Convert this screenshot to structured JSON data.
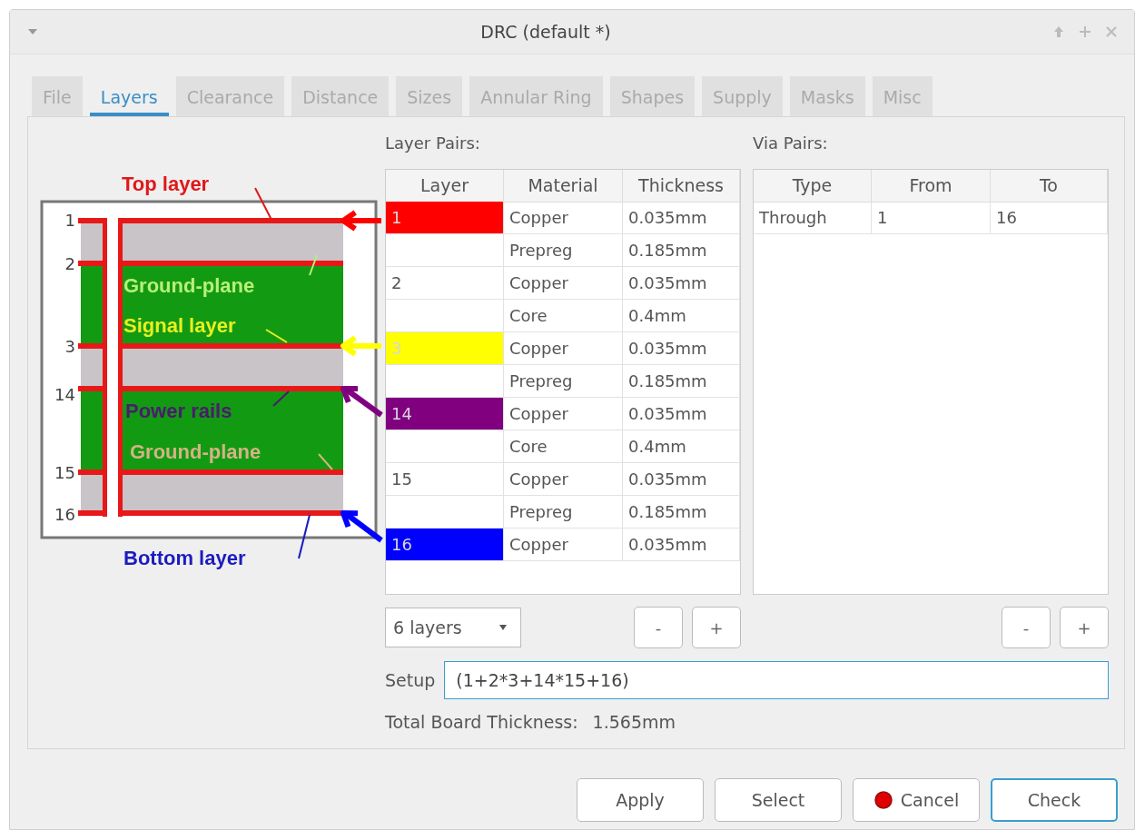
{
  "window": {
    "title": "DRC (default *)"
  },
  "tabs": [
    {
      "label": "File",
      "selected": false
    },
    {
      "label": "Layers",
      "selected": true
    },
    {
      "label": "Clearance",
      "selected": false
    },
    {
      "label": "Distance",
      "selected": false
    },
    {
      "label": "Sizes",
      "selected": false
    },
    {
      "label": "Annular Ring",
      "selected": false
    },
    {
      "label": "Shapes",
      "selected": false
    },
    {
      "label": "Supply",
      "selected": false
    },
    {
      "label": "Masks",
      "selected": false
    },
    {
      "label": "Misc",
      "selected": false
    }
  ],
  "diagram": {
    "layer_numbers": [
      "1",
      "2",
      "3",
      "14",
      "15",
      "16"
    ],
    "labels": [
      {
        "text": "Top layer",
        "color": "#e01818"
      },
      {
        "text": "Ground-plane",
        "color": "#b8f078"
      },
      {
        "text": "Signal layer",
        "color": "#e8f020"
      },
      {
        "text": "Power rails",
        "color": "#4a1c6c"
      },
      {
        "text": "Ground-plane",
        "color": "#d4b484"
      },
      {
        "text": "Bottom layer",
        "color": "#1c1cc0"
      }
    ]
  },
  "layer_pairs": {
    "title": "Layer Pairs:",
    "columns": [
      "Layer",
      "Material",
      "Thickness"
    ],
    "rows": [
      {
        "layer": "1",
        "color": "#ff0000",
        "material": "Copper",
        "thickness": "0.035mm"
      },
      {
        "layer": "",
        "material": "Prepreg",
        "thickness": "0.185mm"
      },
      {
        "layer": "2",
        "material": "Copper",
        "thickness": "0.035mm"
      },
      {
        "layer": "",
        "material": "Core",
        "thickness": "0.4mm"
      },
      {
        "layer": "3",
        "color": "#ffff00",
        "material": "Copper",
        "thickness": "0.035mm"
      },
      {
        "layer": "",
        "material": "Prepreg",
        "thickness": "0.185mm"
      },
      {
        "layer": "14",
        "color": "#800080",
        "material": "Copper",
        "thickness": "0.035mm"
      },
      {
        "layer": "",
        "material": "Core",
        "thickness": "0.4mm"
      },
      {
        "layer": "15",
        "material": "Copper",
        "thickness": "0.035mm"
      },
      {
        "layer": "",
        "material": "Prepreg",
        "thickness": "0.185mm"
      },
      {
        "layer": "16",
        "color": "#0000ff",
        "material": "Copper",
        "thickness": "0.035mm"
      }
    ],
    "layer_count": "6 layers",
    "buttons": [
      "-",
      "+"
    ]
  },
  "via_pairs": {
    "title": "Via Pairs:",
    "columns": [
      "Type",
      "From",
      "To"
    ],
    "rows": [
      [
        "Through",
        "1",
        "16"
      ]
    ],
    "buttons": [
      "-",
      "+"
    ]
  },
  "setup": {
    "label": "Setup",
    "value": "(1+2*3+14*15+16)"
  },
  "total": {
    "label": "Total Board Thickness:",
    "value": "1.565mm"
  },
  "buttons": [
    {
      "label": "Apply",
      "kind": "plain",
      "default": false
    },
    {
      "label": "Select",
      "kind": "plain",
      "default": false
    },
    {
      "label": "Cancel",
      "kind": "stop",
      "default": false
    },
    {
      "label": "Check",
      "kind": "plain",
      "default": true
    }
  ]
}
